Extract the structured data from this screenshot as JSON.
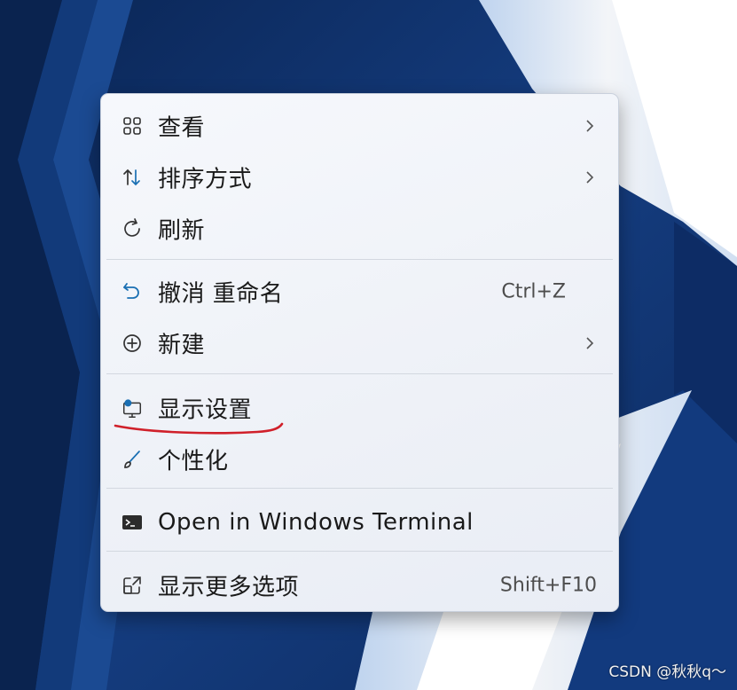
{
  "menu": {
    "items": [
      {
        "label": "查看",
        "icon": "grid-view-icon"
      },
      {
        "label": "排序方式",
        "icon": "sort-icon"
      },
      {
        "label": "刷新",
        "icon": "refresh-icon"
      },
      {
        "label": "撤消 重命名",
        "icon": "undo-icon",
        "shortcut": "Ctrl+Z"
      },
      {
        "label": "新建",
        "icon": "new-plus-icon"
      },
      {
        "label": "显示设置",
        "icon": "display-settings-icon"
      },
      {
        "label": "个性化",
        "icon": "brush-icon"
      },
      {
        "label": "Open in Windows Terminal",
        "icon": "terminal-icon"
      },
      {
        "label": "显示更多选项",
        "icon": "more-options-icon",
        "shortcut": "Shift+F10"
      }
    ]
  },
  "annotation": {
    "color": "#d0202a"
  },
  "colors": {
    "accent": "#1a6fb3",
    "menu_bg": "#f2f4f9",
    "wallpaper": "#0e2f6a"
  },
  "watermark": "CSDN @秋秋q～"
}
